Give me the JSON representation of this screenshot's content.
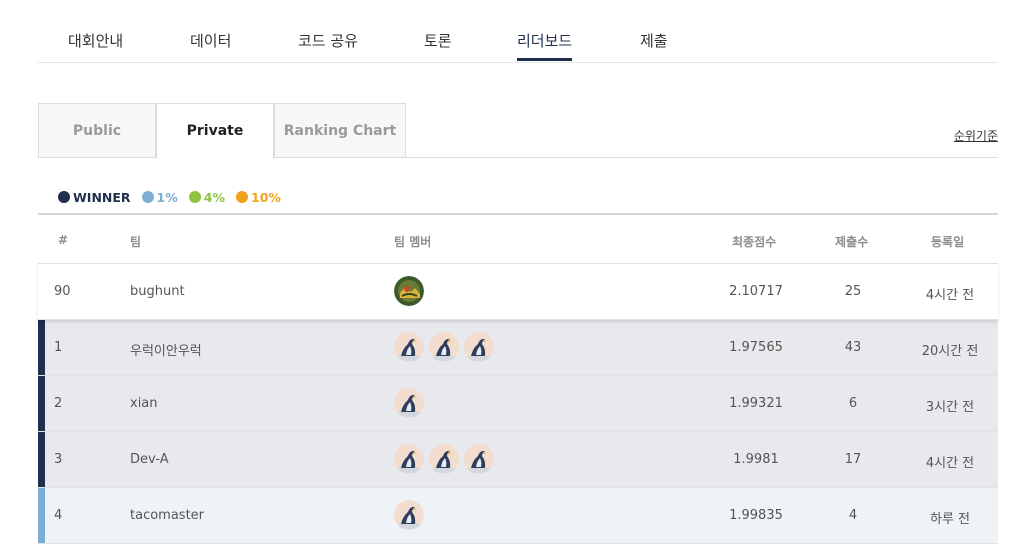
{
  "nav": {
    "items": [
      {
        "label": "대회안내"
      },
      {
        "label": "데이터"
      },
      {
        "label": "코드 공유"
      },
      {
        "label": "토론"
      },
      {
        "label": "리더보드",
        "active": true
      },
      {
        "label": "제출"
      }
    ]
  },
  "tabs": {
    "items": [
      {
        "label": "Public"
      },
      {
        "label": "Private",
        "active": true
      },
      {
        "label": "Ranking Chart"
      }
    ],
    "rank_criteria": "순위기준"
  },
  "legend": [
    {
      "label": "WINNER",
      "color": "#1f2f4d"
    },
    {
      "label": "1%",
      "color": "#7aaed3"
    },
    {
      "label": "4%",
      "color": "#8cc43f"
    },
    {
      "label": "10%",
      "color": "#f0a21d"
    }
  ],
  "table": {
    "headers": {
      "rank": "#",
      "team": "팀",
      "members": "팀 멤버",
      "score": "최종점수",
      "submissions": "제출수",
      "date": "등록일"
    },
    "rows": [
      {
        "rank": "90",
        "team": "bughunt",
        "avatar": "landscape-avatar",
        "members": 1,
        "score": "2.10717",
        "submissions": "25",
        "date": "4시간 전",
        "highlight": "me"
      },
      {
        "rank": "1",
        "team": "우럭이안우럭",
        "avatar": "penguin-avatar",
        "members": 3,
        "score": "1.97565",
        "submissions": "43",
        "date": "20시간 전",
        "highlight": "winner"
      },
      {
        "rank": "2",
        "team": "xian",
        "avatar": "penguin-avatar",
        "members": 1,
        "score": "1.99321",
        "submissions": "6",
        "date": "3시간 전",
        "highlight": "winner"
      },
      {
        "rank": "3",
        "team": "Dev-A",
        "avatar": "penguin-avatar",
        "members": 3,
        "score": "1.9981",
        "submissions": "17",
        "date": "4시간 전",
        "highlight": "winner"
      },
      {
        "rank": "4",
        "team": "tacomaster",
        "avatar": "penguin-avatar",
        "members": 1,
        "score": "1.99835",
        "submissions": "4",
        "date": "하루 전",
        "highlight": "top1"
      }
    ]
  },
  "colors": {
    "winner_bar": "#1f2f4d",
    "top1_bar": "#7aaed3",
    "active_nav": "#1f2f4d"
  }
}
